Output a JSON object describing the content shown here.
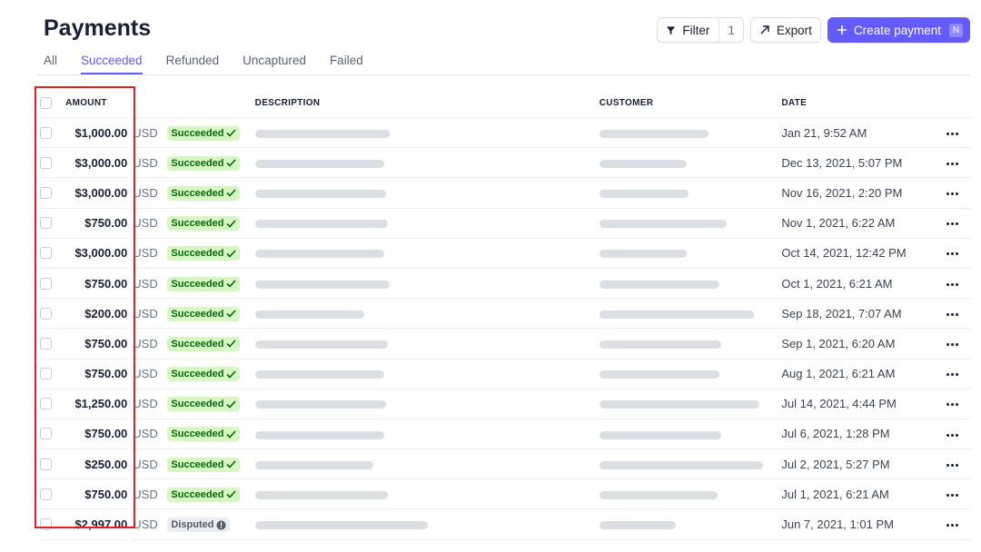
{
  "page": {
    "title": "Payments"
  },
  "toolbar": {
    "filter_label": "Filter",
    "filter_count": "1",
    "export_label": "Export",
    "create_label": "Create payment",
    "create_shortcut": "N",
    "accent_color": "#635bff"
  },
  "tabs": [
    {
      "label": "All",
      "active": false
    },
    {
      "label": "Succeeded",
      "active": true
    },
    {
      "label": "Refunded",
      "active": false
    },
    {
      "label": "Uncaptured",
      "active": false
    },
    {
      "label": "Failed",
      "active": false
    }
  ],
  "table": {
    "columns": {
      "amount": "AMOUNT",
      "description": "DESCRIPTION",
      "customer": "CUSTOMER",
      "date": "DATE"
    },
    "rows": [
      {
        "amount": "$1,000.00",
        "currency": "USD",
        "status": "Succeeded",
        "date": "Jan 21, 9:52 AM"
      },
      {
        "amount": "$3,000.00",
        "currency": "USD",
        "status": "Succeeded",
        "date": "Dec 13, 2021, 5:07 PM"
      },
      {
        "amount": "$3,000.00",
        "currency": "USD",
        "status": "Succeeded",
        "date": "Nov 16, 2021, 2:20 PM"
      },
      {
        "amount": "$750.00",
        "currency": "USD",
        "status": "Succeeded",
        "date": "Nov 1, 2021, 6:22 AM"
      },
      {
        "amount": "$3,000.00",
        "currency": "USD",
        "status": "Succeeded",
        "date": "Oct 14, 2021, 12:42 PM"
      },
      {
        "amount": "$750.00",
        "currency": "USD",
        "status": "Succeeded",
        "date": "Oct 1, 2021, 6:21 AM"
      },
      {
        "amount": "$200.00",
        "currency": "USD",
        "status": "Succeeded",
        "date": "Sep 18, 2021, 7:07 AM"
      },
      {
        "amount": "$750.00",
        "currency": "USD",
        "status": "Succeeded",
        "date": "Sep 1, 2021, 6:20 AM"
      },
      {
        "amount": "$750.00",
        "currency": "USD",
        "status": "Succeeded",
        "date": "Aug 1, 2021, 6:21 AM"
      },
      {
        "amount": "$1,250.00",
        "currency": "USD",
        "status": "Succeeded",
        "date": "Jul 14, 2021, 4:44 PM"
      },
      {
        "amount": "$750.00",
        "currency": "USD",
        "status": "Succeeded",
        "date": "Jul 6, 2021, 1:28 PM"
      },
      {
        "amount": "$250.00",
        "currency": "USD",
        "status": "Succeeded",
        "date": "Jul 2, 2021, 5:27 PM"
      },
      {
        "amount": "$750.00",
        "currency": "USD",
        "status": "Succeeded",
        "date": "Jul 1, 2021, 6:21 AM"
      },
      {
        "amount": "$2,997.00",
        "currency": "USD",
        "status": "Disputed",
        "date": "Jun 7, 2021, 1:01 PM"
      }
    ]
  },
  "highlight": {
    "color": "#e0201f"
  }
}
